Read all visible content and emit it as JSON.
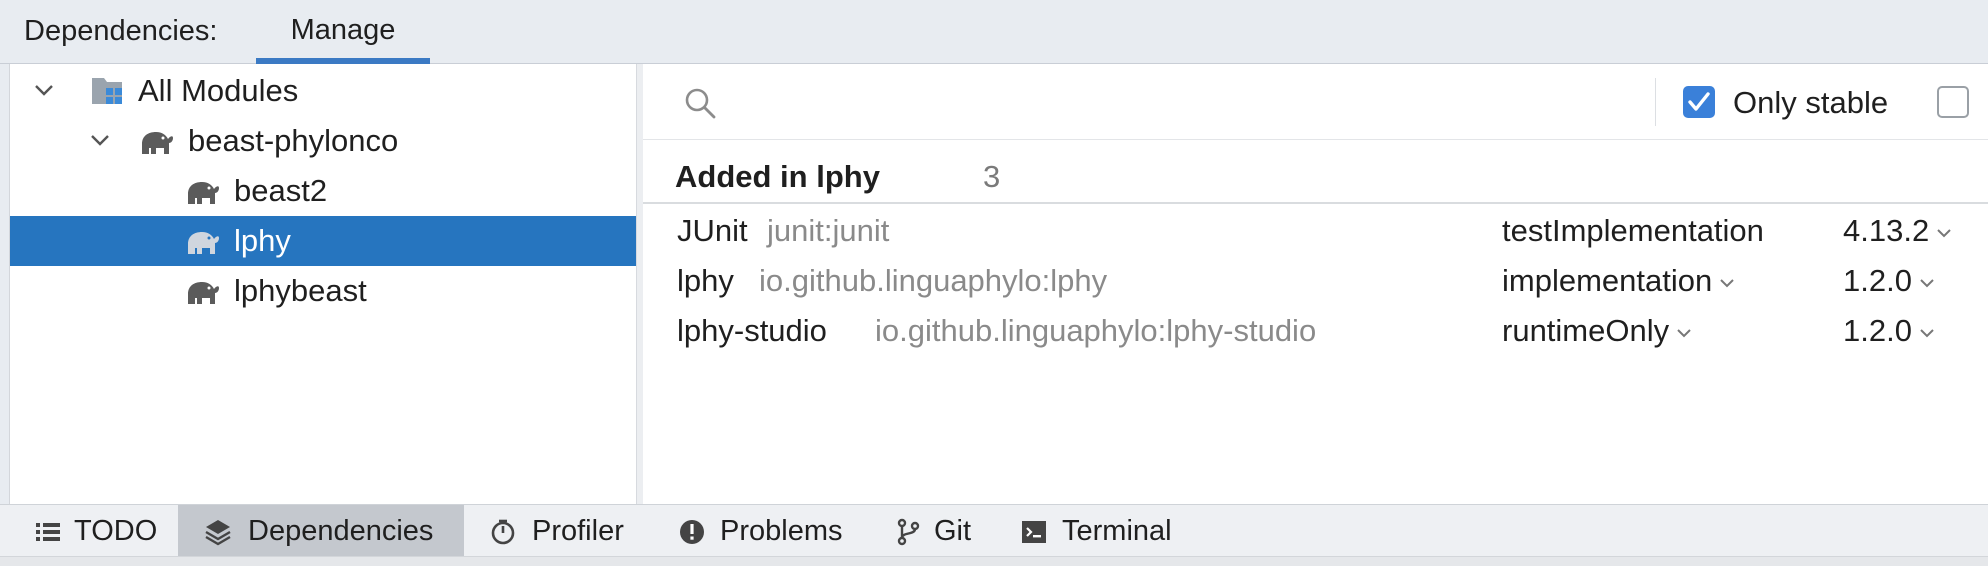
{
  "header": {
    "title": "Dependencies:",
    "tab_label": "Manage"
  },
  "tree": {
    "items": [
      {
        "label": "All Modules",
        "icon": "modules-icon",
        "expanded": true
      },
      {
        "label": "beast-phylonco",
        "icon": "gradle-elephant-icon",
        "expanded": true
      },
      {
        "label": "beast2",
        "icon": "gradle-elephant-icon"
      },
      {
        "label": "lphy",
        "icon": "gradle-elephant-icon",
        "selected": true
      },
      {
        "label": "lphybeast",
        "icon": "gradle-elephant-icon"
      }
    ]
  },
  "search": {
    "placeholder": "",
    "value": "",
    "only_stable_label": "Only stable",
    "only_stable_checked": true,
    "second_checkbox_checked": false
  },
  "section": {
    "title": "Added in lphy",
    "count": "3"
  },
  "dependencies": [
    {
      "name": "JUnit",
      "coordinate": "junit:junit",
      "configuration": "testImplementation",
      "version": "4.13.2"
    },
    {
      "name": "lphy",
      "coordinate": "io.github.linguaphylo:lphy",
      "configuration": "implementation",
      "version": "1.2.0"
    },
    {
      "name": "lphy-studio",
      "coordinate": "io.github.linguaphylo:lphy-studio",
      "configuration": "runtimeOnly",
      "version": "1.2.0"
    }
  ],
  "toolbar": {
    "items": [
      {
        "label": "TODO",
        "icon": "list-icon"
      },
      {
        "label": "Dependencies",
        "icon": "layers-icon",
        "active": true
      },
      {
        "label": "Profiler",
        "icon": "profiler-icon"
      },
      {
        "label": "Problems",
        "icon": "warning-icon"
      },
      {
        "label": "Git",
        "icon": "git-branch-icon"
      },
      {
        "label": "Terminal",
        "icon": "terminal-icon"
      }
    ]
  },
  "colors": {
    "selection": "#2675bf",
    "accent": "#3b7ac4",
    "checkbox": "#3a80d9"
  }
}
